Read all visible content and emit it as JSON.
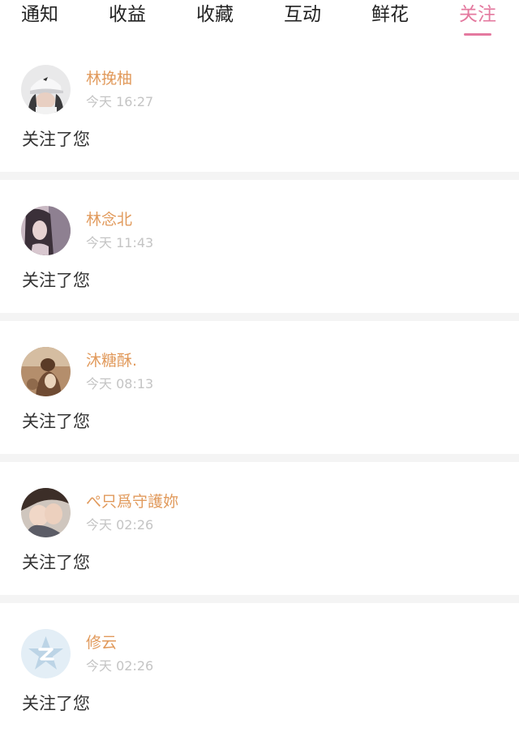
{
  "tabs": [
    {
      "label": "通知"
    },
    {
      "label": "收益"
    },
    {
      "label": "收藏"
    },
    {
      "label": "互动"
    },
    {
      "label": "鲜花"
    },
    {
      "label": "关注"
    }
  ],
  "active_tab": "关注",
  "colors": {
    "accent": "#e4799f",
    "username": "#e19a5c",
    "timestamp": "#c4c4c4",
    "divider": "#f4f4f4"
  },
  "notifications": [
    {
      "name": "林挽柚",
      "time": "今天 16:27",
      "message": "关注了您",
      "avatar": "avatar-girl-cap-icon"
    },
    {
      "name": "林念北",
      "time": "今天 11:43",
      "message": "关注了您",
      "avatar": "avatar-girl-dark-icon"
    },
    {
      "name": "沐糖酥.",
      "time": "今天 08:13",
      "message": "关注了您",
      "avatar": "avatar-sepia-photo-icon"
    },
    {
      "name": "ぺ只爲守護妳",
      "time": "今天 02:26",
      "message": "关注了您",
      "avatar": "avatar-couple-icon"
    },
    {
      "name": "修云",
      "time": "今天 02:26",
      "message": "关注了您",
      "avatar": "avatar-qq-default-icon"
    }
  ]
}
